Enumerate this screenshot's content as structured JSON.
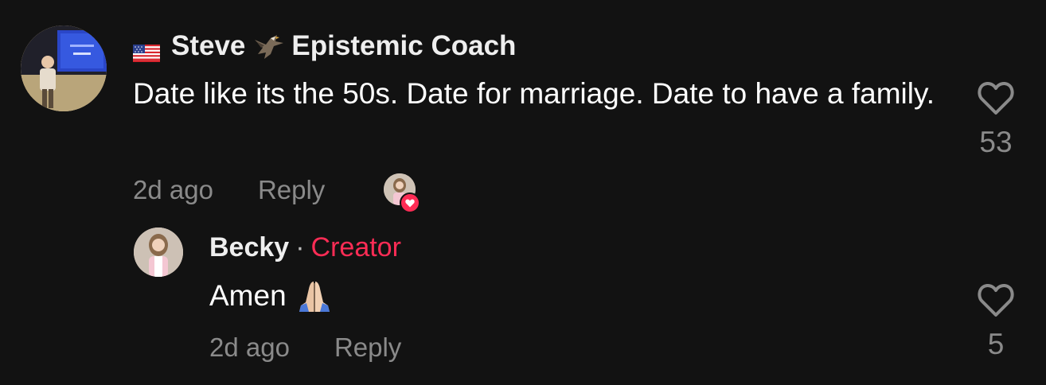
{
  "comment": {
    "author": "Steve",
    "author_badge": "Epistemic Coach",
    "flag_icon": "us-flag-icon",
    "badge_icon": "eagle-icon",
    "text": "Date like its the 50s. Date for marriage. Date to have a family.",
    "timestamp": "2d ago",
    "reply_label": "Reply",
    "like_count": "53",
    "liked_by_creator": true
  },
  "reply": {
    "author": "Becky",
    "separator": "·",
    "role_label": "Creator",
    "text": "Amen",
    "emoji_icon": "praying-hands-icon",
    "timestamp": "2d ago",
    "reply_label": "Reply",
    "like_count": "5"
  },
  "colors": {
    "background": "#121212",
    "creator_accent": "#fe2c55",
    "muted_text": "#8a8a8a"
  }
}
